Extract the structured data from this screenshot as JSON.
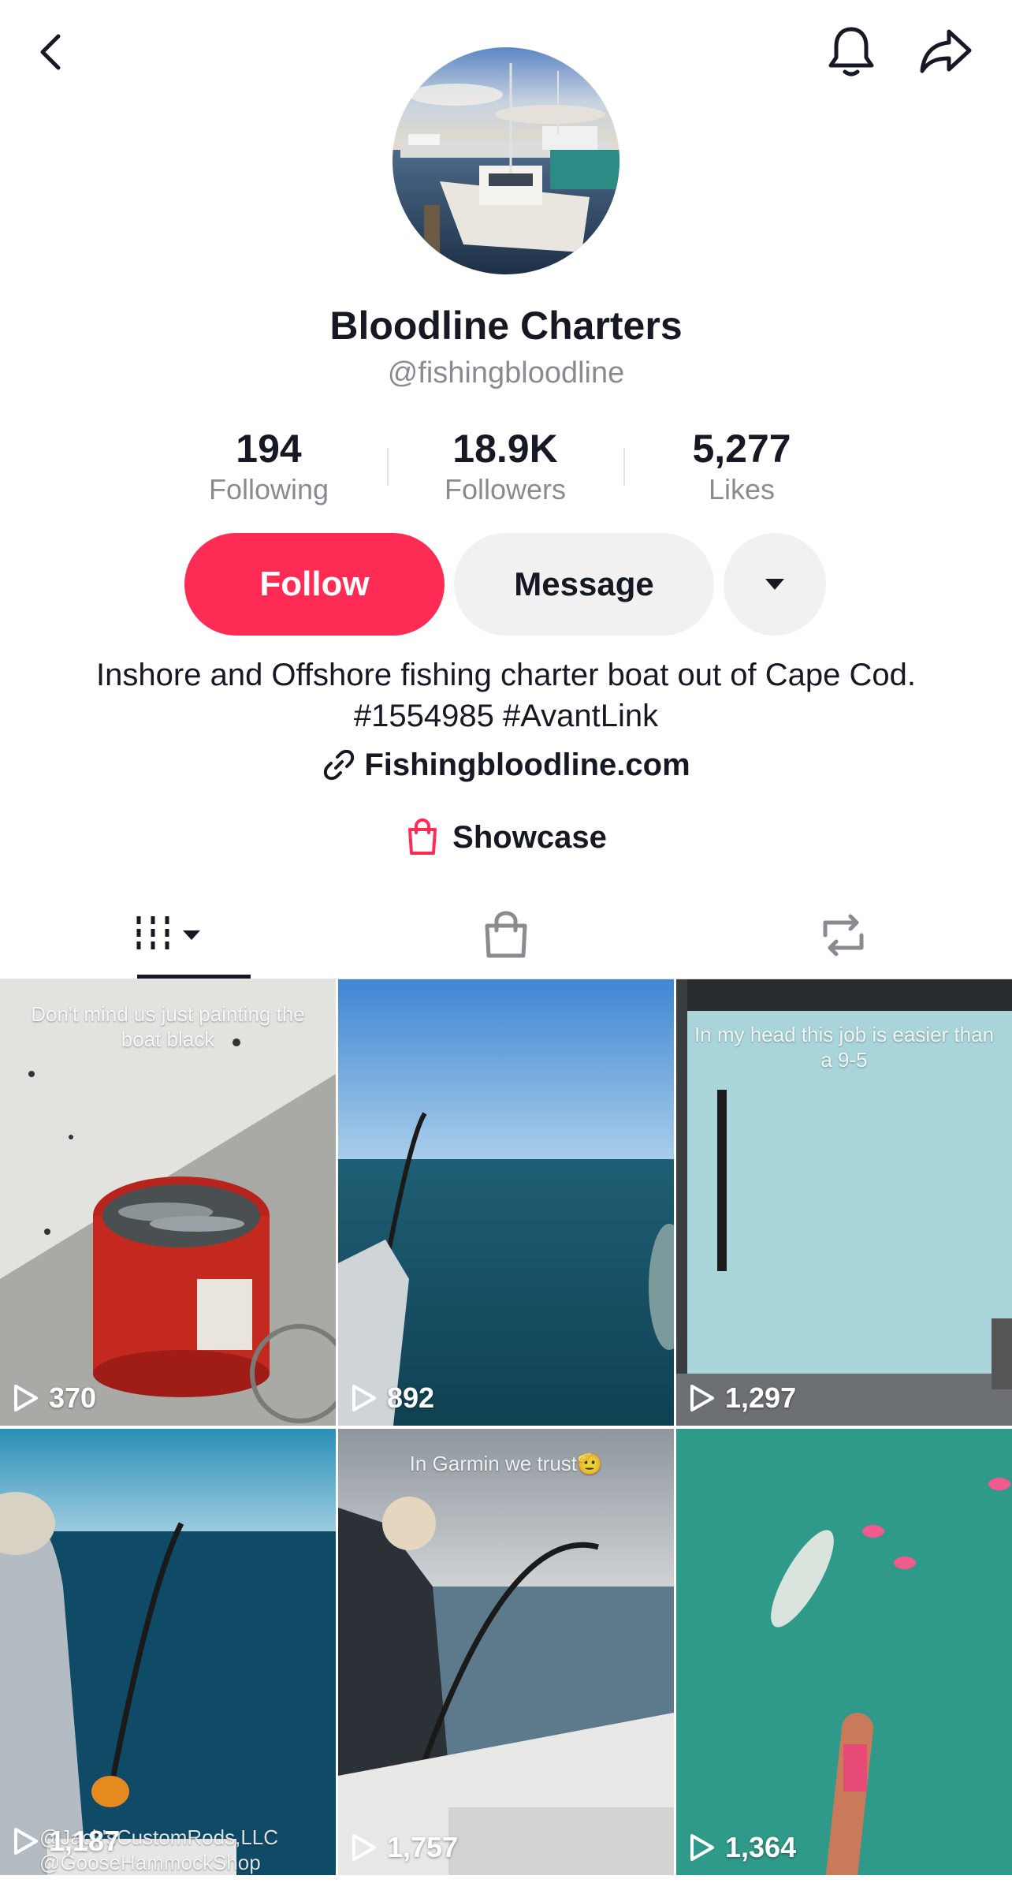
{
  "profile": {
    "display_name": "Bloodline Charters",
    "handle": "@fishingbloodline",
    "bio": "Inshore and Offshore fishing charter boat out of Cape Cod. #1554985 #AvantLink",
    "link": "Fishingbloodline.com",
    "showcase_label": "Showcase"
  },
  "stats": {
    "following": {
      "value": "194",
      "label": "Following"
    },
    "followers": {
      "value": "18.9K",
      "label": "Followers"
    },
    "likes": {
      "value": "5,277",
      "label": "Likes"
    }
  },
  "actions": {
    "follow_label": "Follow",
    "message_label": "Message"
  },
  "icons": {
    "back": "chevron-left-icon",
    "notifications": "bell-icon",
    "share": "share-arrow-icon",
    "more": "caret-down-icon",
    "link": "link-icon",
    "showcase": "shopping-bag-icon"
  },
  "colors": {
    "accent": "#fe2c55",
    "secondary_button": "#f1f1f2",
    "muted_text": "#8a8b91"
  },
  "videos": [
    {
      "caption": "Don't mind us just painting the boat black",
      "views": "370"
    },
    {
      "caption": "",
      "views": "892"
    },
    {
      "caption": "In my head this job is easier than a 9-5",
      "views": "1,297"
    },
    {
      "caption": "",
      "views": "1,187",
      "tags": [
        "@Jack'sCustomRods,LLC",
        "@GooseHammockShop"
      ]
    },
    {
      "caption": "In Garmin we trust🫡",
      "views": "1,757"
    },
    {
      "caption": "",
      "views": "1,364"
    }
  ]
}
